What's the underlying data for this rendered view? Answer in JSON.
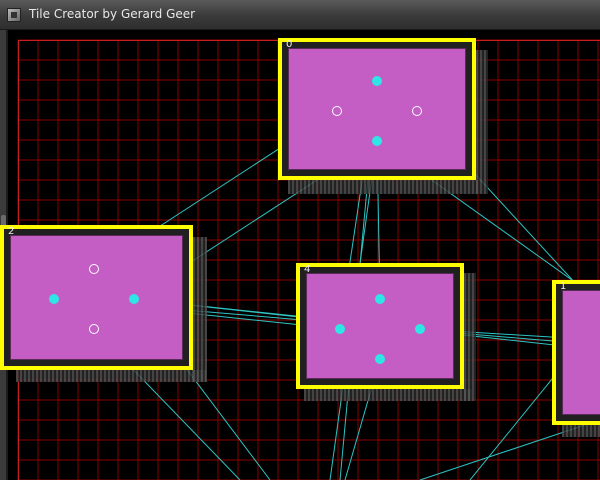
{
  "window": {
    "title": "Tile Creator by Gerard Geer"
  },
  "tiles": [
    {
      "id": "0"
    },
    {
      "id": "2"
    },
    {
      "id": "4"
    },
    {
      "id": "1"
    }
  ],
  "colors": {
    "grid": "#8b0000",
    "grid_border": "#c82020",
    "tile_border": "#ffff00",
    "tile_fill": "#c45ec4",
    "link": "#2ec4c4",
    "node": "#2ee6e6"
  }
}
